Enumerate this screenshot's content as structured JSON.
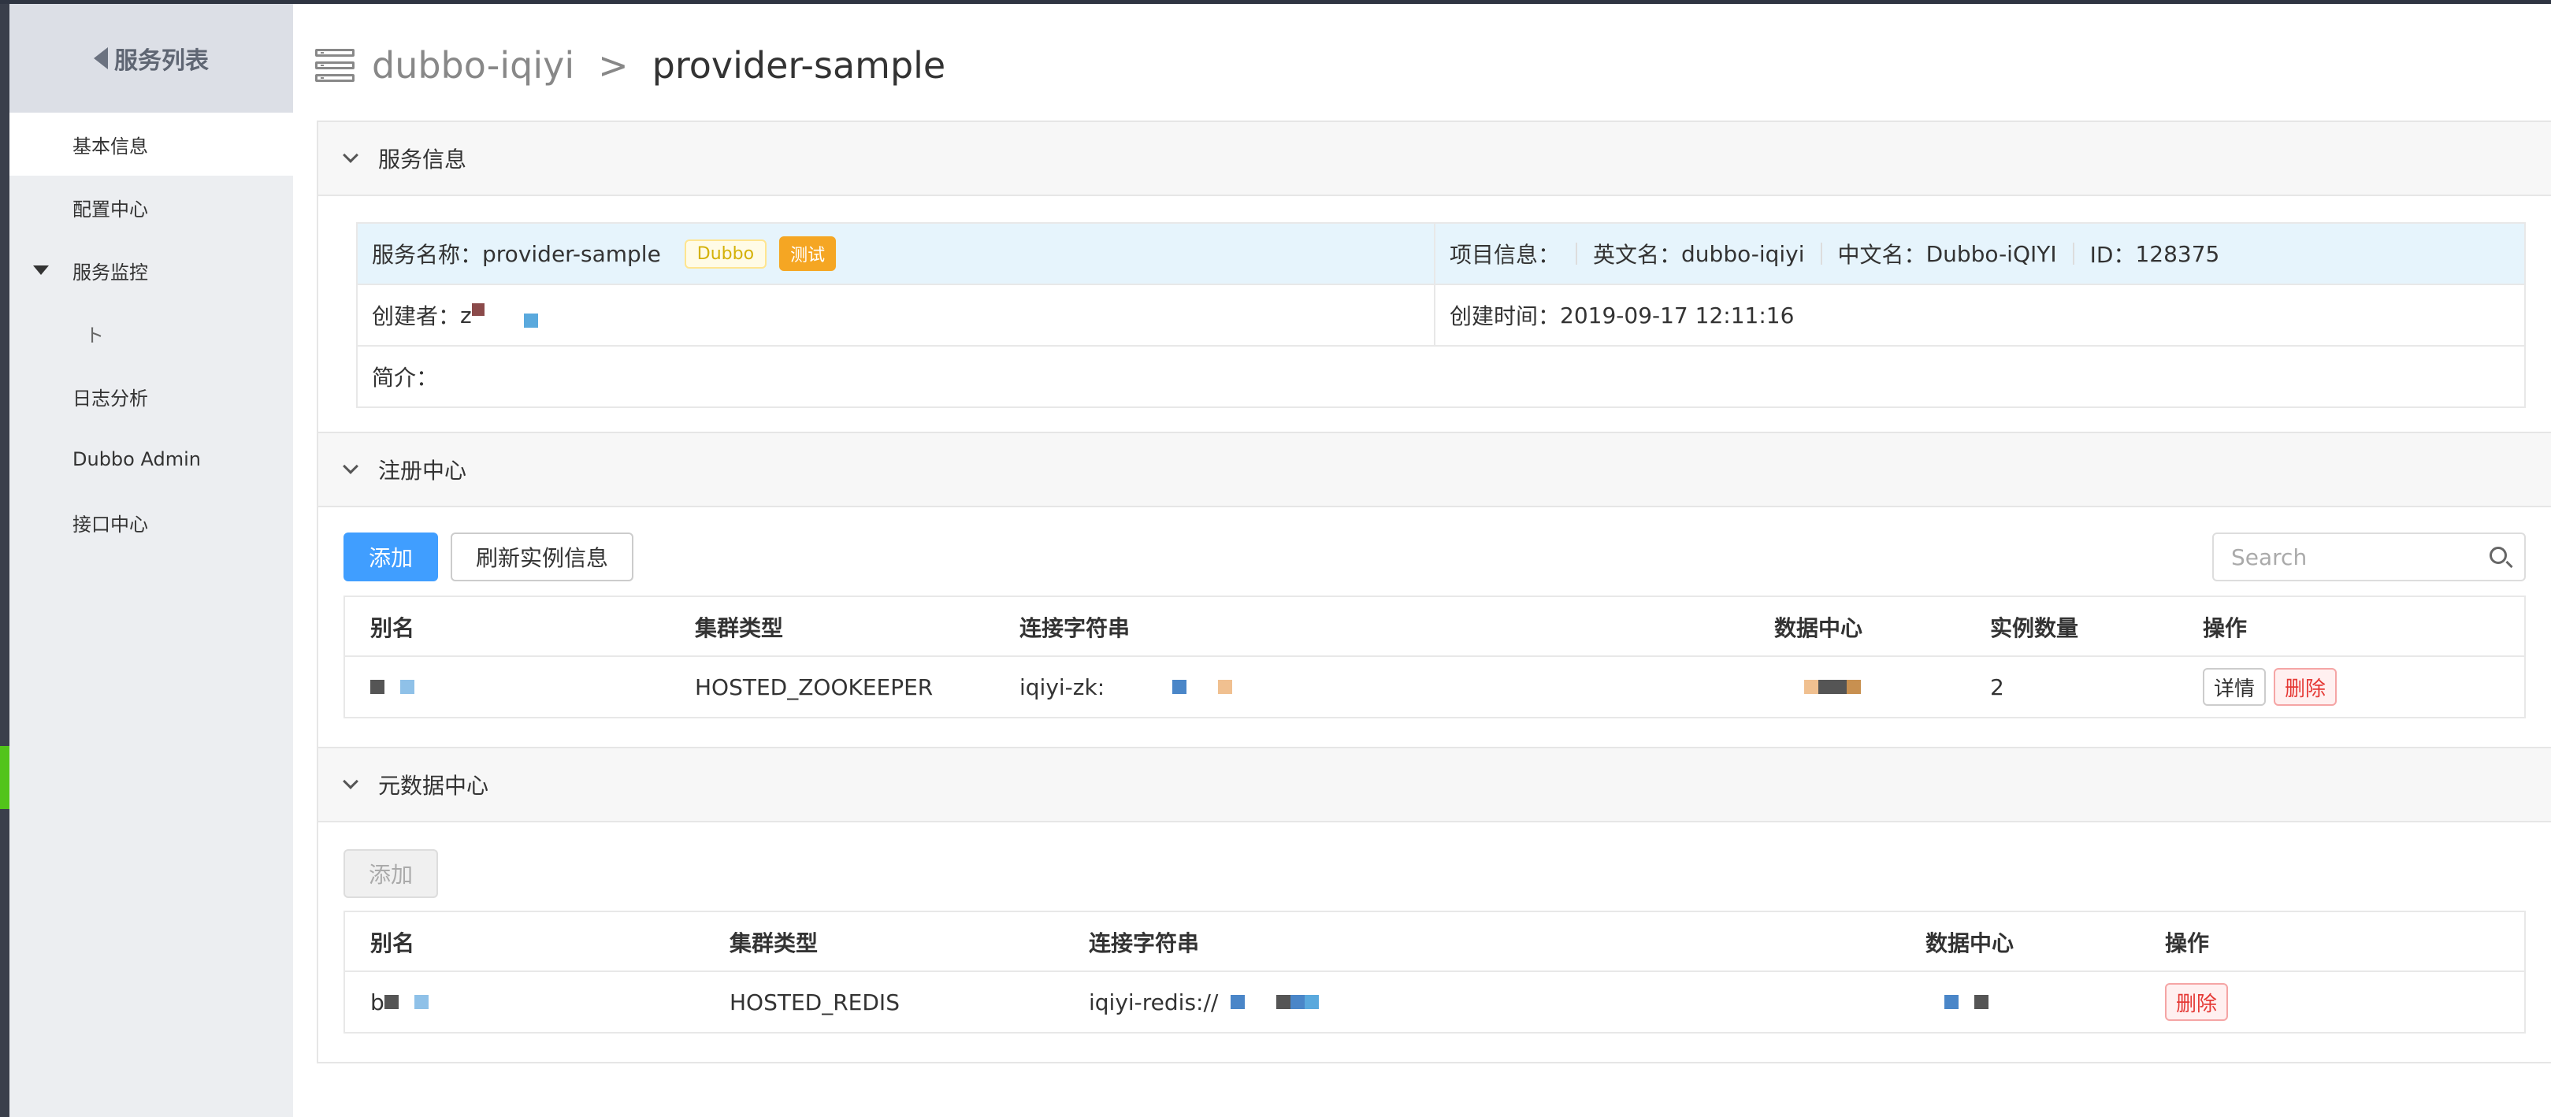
{
  "sidebar": {
    "header": "服务列表",
    "items": [
      {
        "label": "基本信息"
      },
      {
        "label": "配置中心"
      },
      {
        "label": "服务监控"
      },
      {
        "label": "ト"
      },
      {
        "label": "日志分析"
      },
      {
        "label": "Dubbo Admin"
      },
      {
        "label": "接口中心"
      }
    ]
  },
  "header": {
    "app": "dubbo-iqiyi",
    "separator": ">",
    "service": "provider-sample"
  },
  "service_info": {
    "title": "服务信息",
    "name_label": "服务名称：",
    "name_value": "provider-sample",
    "tag_dubbo": "Dubbo",
    "tag_test": "测试",
    "project_label": "项目信息：",
    "en_label": "英文名：",
    "en_value": "dubbo-iqiyi",
    "cn_label": "中文名：",
    "cn_value": "Dubbo-iQIYI",
    "id_label": "ID：",
    "id_value": "128375",
    "creator_label": "创建者：",
    "creator_value": "z",
    "created_label": "创建时间：",
    "created_value": "2019-09-17 12:11:16",
    "intro_label": "简介："
  },
  "registry": {
    "title": "注册中心",
    "add_label": "添加",
    "refresh_label": "刷新实例信息",
    "search_placeholder": "Search",
    "columns": [
      "别名",
      "集群类型",
      "连接字符串",
      "数据中心",
      "实例数量",
      "操作"
    ],
    "rows": [
      {
        "alias": "",
        "cluster": "HOSTED_ZOOKEEPER",
        "conn": "iqiyi-zk:",
        "dc": "",
        "count": "2",
        "detail": "详情",
        "delete": "删除"
      }
    ]
  },
  "metadata": {
    "title": "元数据中心",
    "add_label": "添加",
    "columns": [
      "别名",
      "集群类型",
      "连接字符串",
      "数据中心",
      "操作"
    ],
    "rows": [
      {
        "alias": "b",
        "cluster": "HOSTED_REDIS",
        "conn": "iqiyi-redis://",
        "dc": "",
        "delete": "删除"
      }
    ]
  },
  "colors": {
    "primary": "#409eff",
    "active_green": "#52c41a",
    "danger": "#e53935",
    "warning": "#f5a623"
  }
}
